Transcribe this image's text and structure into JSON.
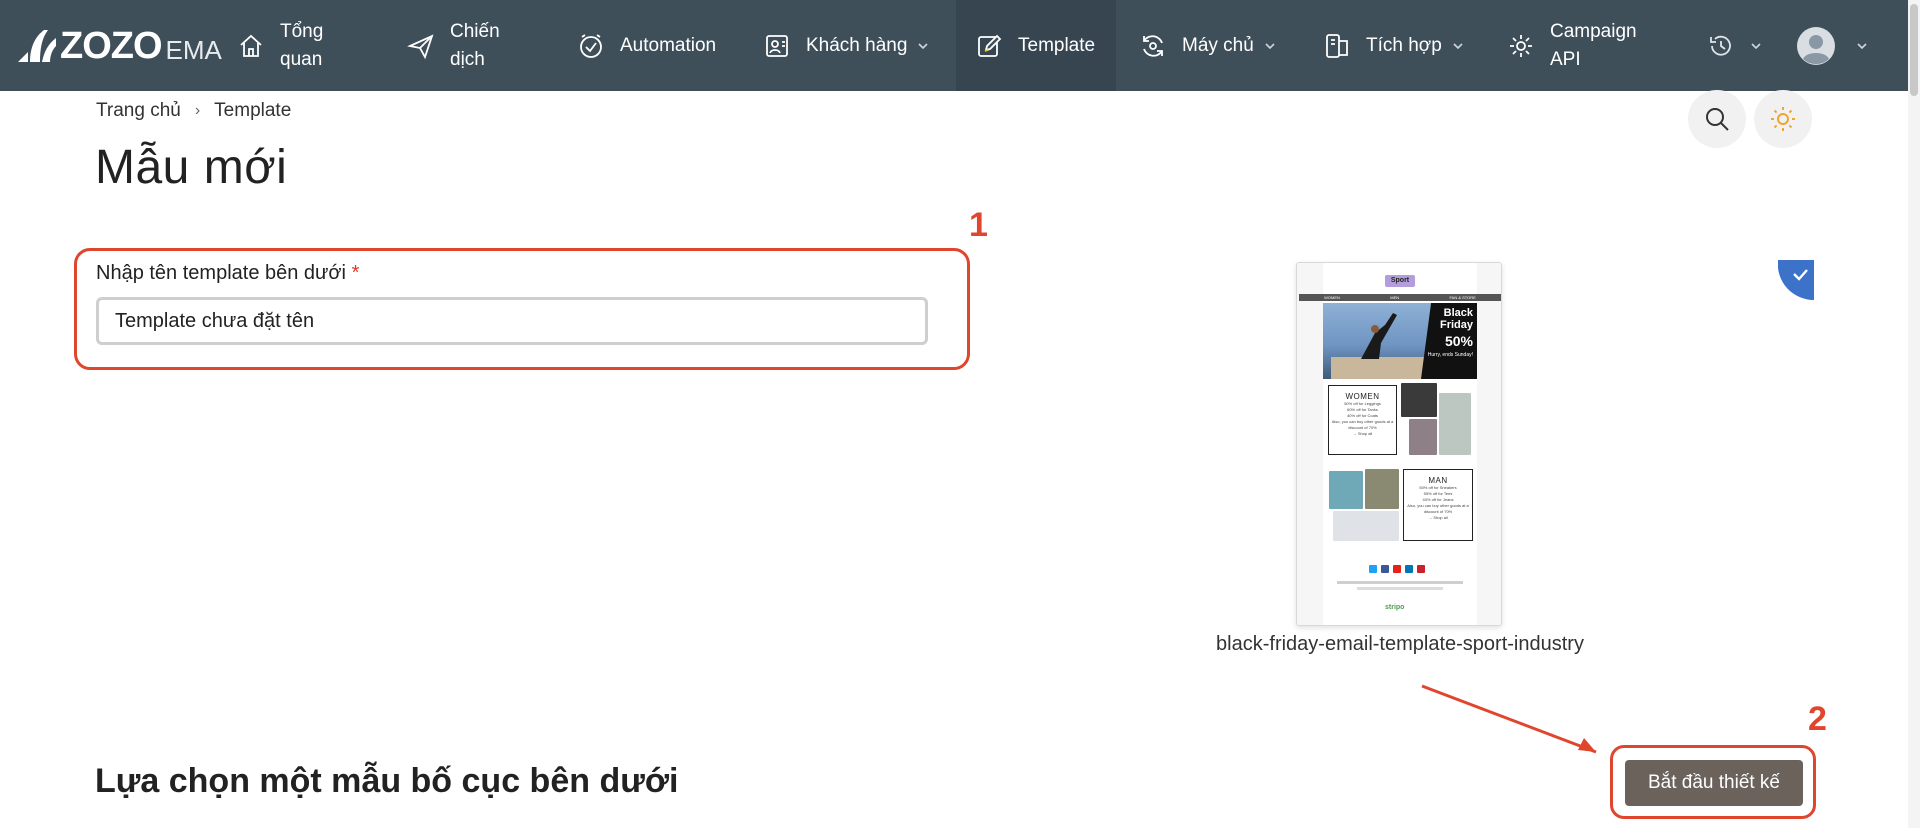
{
  "brand": {
    "logo_text": "ZOZO",
    "logo_sub": "EMA"
  },
  "nav": {
    "overview": "Tổng\nquan",
    "campaign": "Chiến\ndịch",
    "automation": "Automation",
    "customers": "Khách hàng",
    "template": "Template",
    "servers": "Máy chủ",
    "integration": "Tích hợp",
    "campaign_api": "Campaign\nAPI"
  },
  "breadcrumb": {
    "home": "Trang chủ",
    "separator": "›",
    "current": "Template"
  },
  "page": {
    "title": "Mẫu mới"
  },
  "name_field": {
    "label": "Nhập tên template bên dưới",
    "required_mark": "*",
    "value": "Template chưa đặt tên"
  },
  "annotations": {
    "one": "1",
    "two": "2"
  },
  "template_card": {
    "caption": "black-friday-email-template-sport-industry",
    "preview": {
      "brand": "Sport",
      "menu": [
        "WOMEN",
        "MEN",
        "FAN & STORE"
      ],
      "hero_line1": "Black",
      "hero_line2": "Friday",
      "hero_discount": "50%",
      "hero_note": "Hurry, ends Sunday!",
      "women_heading": "WOMEN",
      "women_lines": [
        "50% off for Leggings",
        "60% off for Tanks",
        "40% off for Coats",
        "Also, you can buy other goods at a discount of 70%",
        "→ Shop all"
      ],
      "man_heading": "MAN",
      "man_lines": [
        "50% off for Sneakers",
        "55% off for Tees",
        "40% off for Jeans",
        "Also, you can buy other goods at a discount of 70%",
        "→ Shop all"
      ],
      "footer_brand": "stripo"
    }
  },
  "section": {
    "choose_layout": "Lựa chọn một mẫu bố cục bên dưới"
  },
  "buttons": {
    "start_design": "Bắt đầu thiết kế"
  },
  "colors": {
    "topbar": "#3f4f5a",
    "annotation": "#e0452e",
    "primary_button": "#6b625c",
    "check_badge": "#3d72c9"
  }
}
